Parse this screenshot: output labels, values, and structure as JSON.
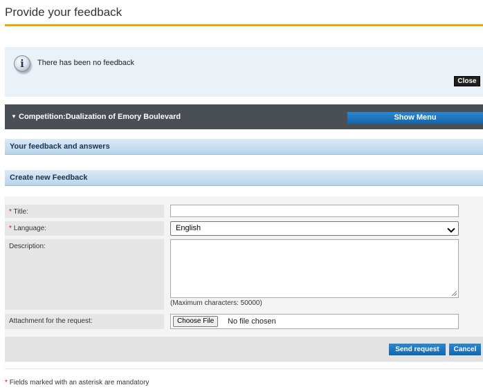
{
  "page": {
    "title": "Provide your feedback"
  },
  "info": {
    "icon": "info-icon",
    "icon_glyph": "i",
    "message": "There has been no feedback",
    "close_label": "Close"
  },
  "competition": {
    "label": "Competition:Dualization of Emory Boulevard",
    "chevron": "▼",
    "show_menu_label": "Show Menu"
  },
  "sections": {
    "feedback_answers": "Your feedback and answers",
    "create_new": "Create new Feedback"
  },
  "form": {
    "required_marker": "*",
    "title_label": "Title:",
    "title_value": "",
    "language_label": "Language:",
    "language_selected": "English",
    "description_label": "Description:",
    "description_value": "",
    "max_characters": "(Maximum characters: 50000)",
    "attachment_label": "Attachment for the request:",
    "choose_file_label": "Choose File",
    "file_status": "No file chosen"
  },
  "actions": {
    "send_label": "Send request",
    "cancel_label": "Cancel"
  },
  "footer": {
    "mandatory_note": "Fields marked with an asterisk are mandatory"
  },
  "colors": {
    "accent_rule": "#f0a500",
    "primary_button": "#1a73c0",
    "header_bar": "#4a4f55",
    "required": "#d0021b"
  }
}
